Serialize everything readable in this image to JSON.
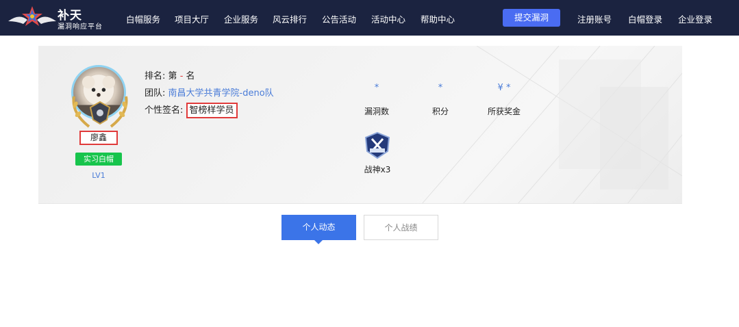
{
  "brand": {
    "title": "补天",
    "subtitle": "漏洞响应平台"
  },
  "nav": [
    {
      "label": "白帽服务"
    },
    {
      "label": "项目大厅"
    },
    {
      "label": "企业服务"
    },
    {
      "label": "风云排行"
    },
    {
      "label": "公告活动"
    },
    {
      "label": "活动中心"
    },
    {
      "label": "帮助中心"
    }
  ],
  "header_actions": {
    "submit": "提交漏洞",
    "register": "注册账号",
    "whitehat_login": "白帽登录",
    "company_login": "企业登录"
  },
  "profile": {
    "name": "廖鑫",
    "rank_title": "实习白帽",
    "level": "LV1",
    "rank_label": "排名:",
    "rank_prefix": "第",
    "rank_value": "-",
    "rank_suffix": "名",
    "team_label": "团队:",
    "team_name": "南昌大学共青学院-deno队",
    "signature_label": "个性签名:",
    "signature": "智榜样学员"
  },
  "stats": [
    {
      "value": "*",
      "label": "漏洞数"
    },
    {
      "value": "*",
      "label": "积分"
    },
    {
      "value": "¥ *",
      "label": "所获奖金"
    }
  ],
  "medal": {
    "label": "战神x3",
    "icon": "war-god-medal-icon"
  },
  "tabs": [
    {
      "label": "个人动态",
      "active": true
    },
    {
      "label": "个人战绩",
      "active": false
    }
  ],
  "colors": {
    "header_bg": "#1b2340",
    "accent": "#4a6cf2",
    "link": "#4a7cd8",
    "highlight_red": "#e03a3a",
    "badge_green": "#17c44c",
    "tab_active": "#3b74e8"
  }
}
